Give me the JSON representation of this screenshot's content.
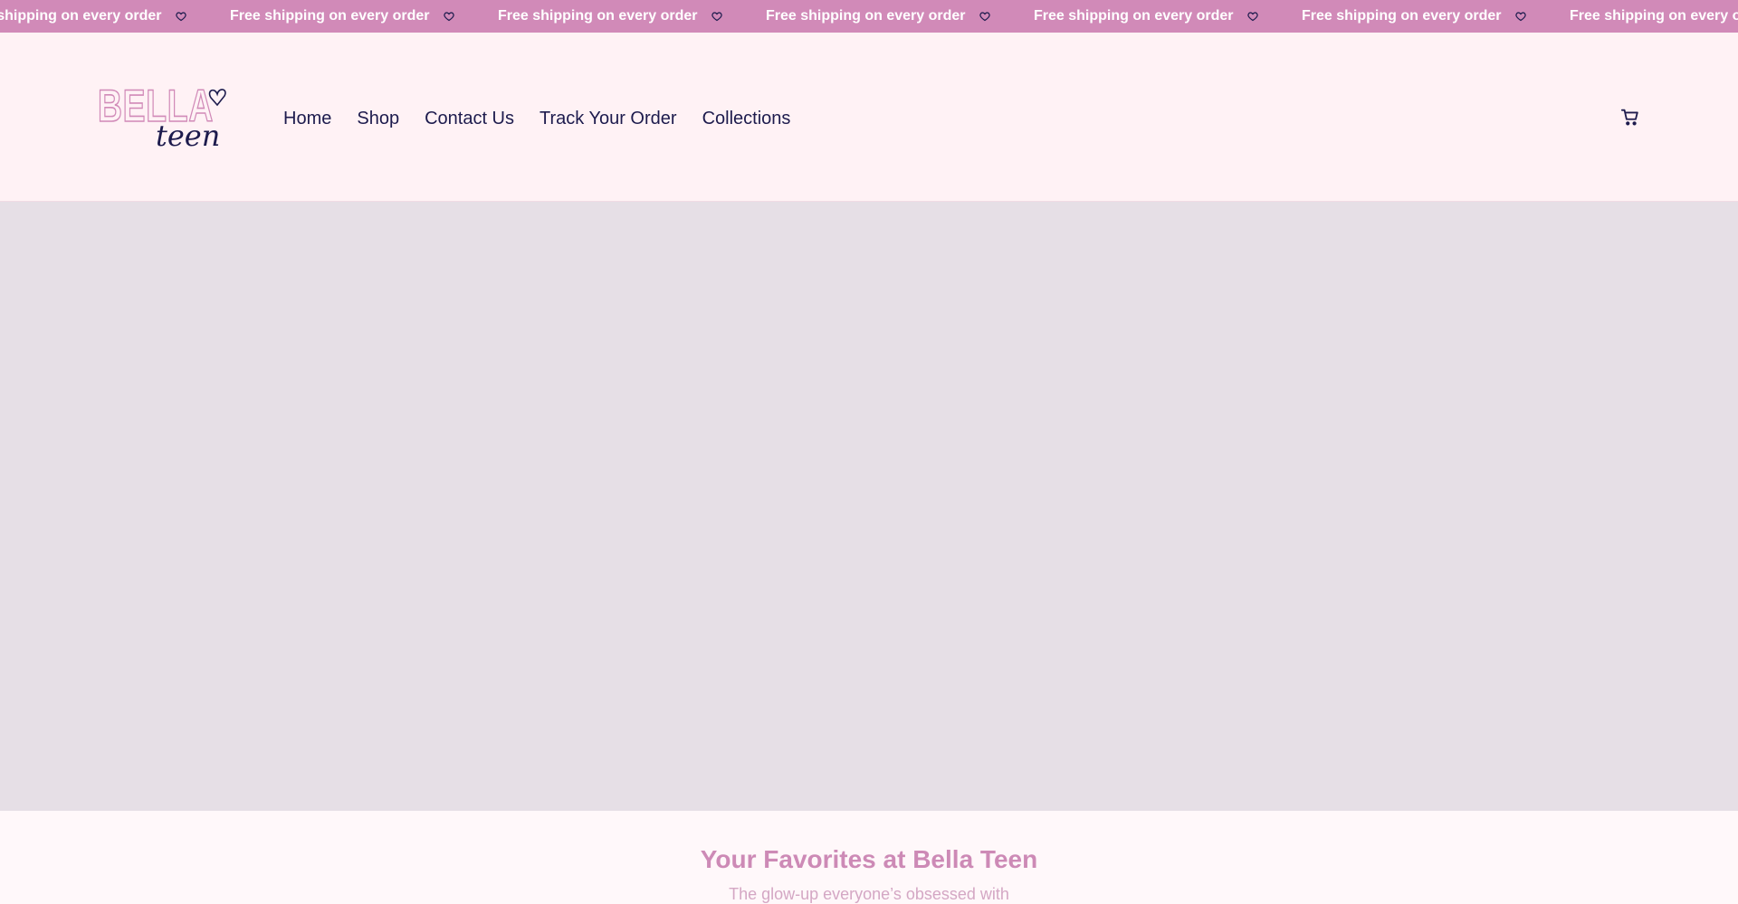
{
  "announcement": {
    "items": [
      {
        "text": "Free shipping on every order",
        "icon": "heart-icon"
      },
      {
        "text": "Free shipping on every order",
        "icon": "heart-icon"
      },
      {
        "text": "Free shipping on every order",
        "icon": "heart-icon"
      },
      {
        "text": "Free shipping on every order",
        "icon": "heart-icon"
      },
      {
        "text": "Free shipping on every order",
        "icon": "heart-icon"
      },
      {
        "text": "Free shipping on every order",
        "icon": "heart-icon"
      },
      {
        "text": "Free shipping on every order",
        "icon": "heart-icon"
      }
    ]
  },
  "header": {
    "logo": {
      "word1": "BELLA",
      "word2": "teen"
    },
    "nav": [
      {
        "label": "Home"
      },
      {
        "label": "Shop"
      },
      {
        "label": "Contact Us"
      },
      {
        "label": "Track Your Order"
      },
      {
        "label": "Collections"
      }
    ],
    "cart_icon": "cart-icon"
  },
  "favorites": {
    "title": "Your Favorites at Bella Teen",
    "subtitle": "The glow-up everyone’s obsessed with"
  },
  "colors": {
    "announcement_bg": "#d18ab8",
    "header_bg": "#fff2f5",
    "nav_text": "#1d1b4d",
    "hero_bg": "#e6dfe6",
    "accent_pink": "#cd8ab6"
  }
}
